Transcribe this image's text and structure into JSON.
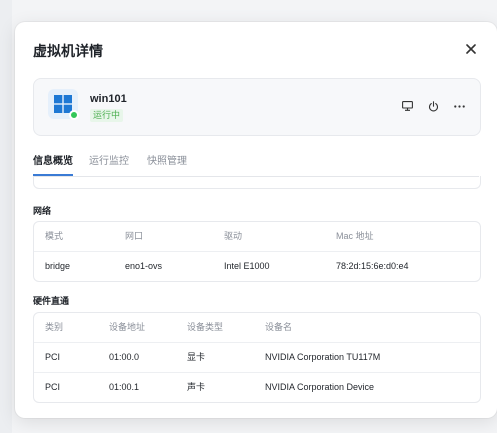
{
  "modal": {
    "title": "虚拟机详情"
  },
  "vm": {
    "name": "win101",
    "status": "运行中",
    "os_icon": "windows-logo",
    "actions": [
      "monitor-icon",
      "power-icon",
      "more-icon"
    ]
  },
  "tabs": [
    {
      "label": "信息概览",
      "active": true
    },
    {
      "label": "运行监控",
      "active": false
    },
    {
      "label": "快照管理",
      "active": false
    }
  ],
  "network": {
    "title": "网络",
    "headers": [
      "模式",
      "网口",
      "驱动",
      "Mac 地址"
    ],
    "rows": [
      [
        "bridge",
        "eno1-ovs",
        "Intel E1000",
        "78:2d:15:6e:d0:e4"
      ]
    ]
  },
  "passthrough": {
    "title": "硬件直通",
    "headers": [
      "类别",
      "设备地址",
      "设备类型",
      "设备名"
    ],
    "rows": [
      [
        "PCI",
        "01:00.0",
        "显卡",
        "NVIDIA Corporation TU117M"
      ],
      [
        "PCI",
        "01:00.1",
        "声卡",
        "NVIDIA Corporation Device"
      ]
    ]
  },
  "colors": {
    "accent": "#3a7bd5",
    "running": "#34c759"
  }
}
